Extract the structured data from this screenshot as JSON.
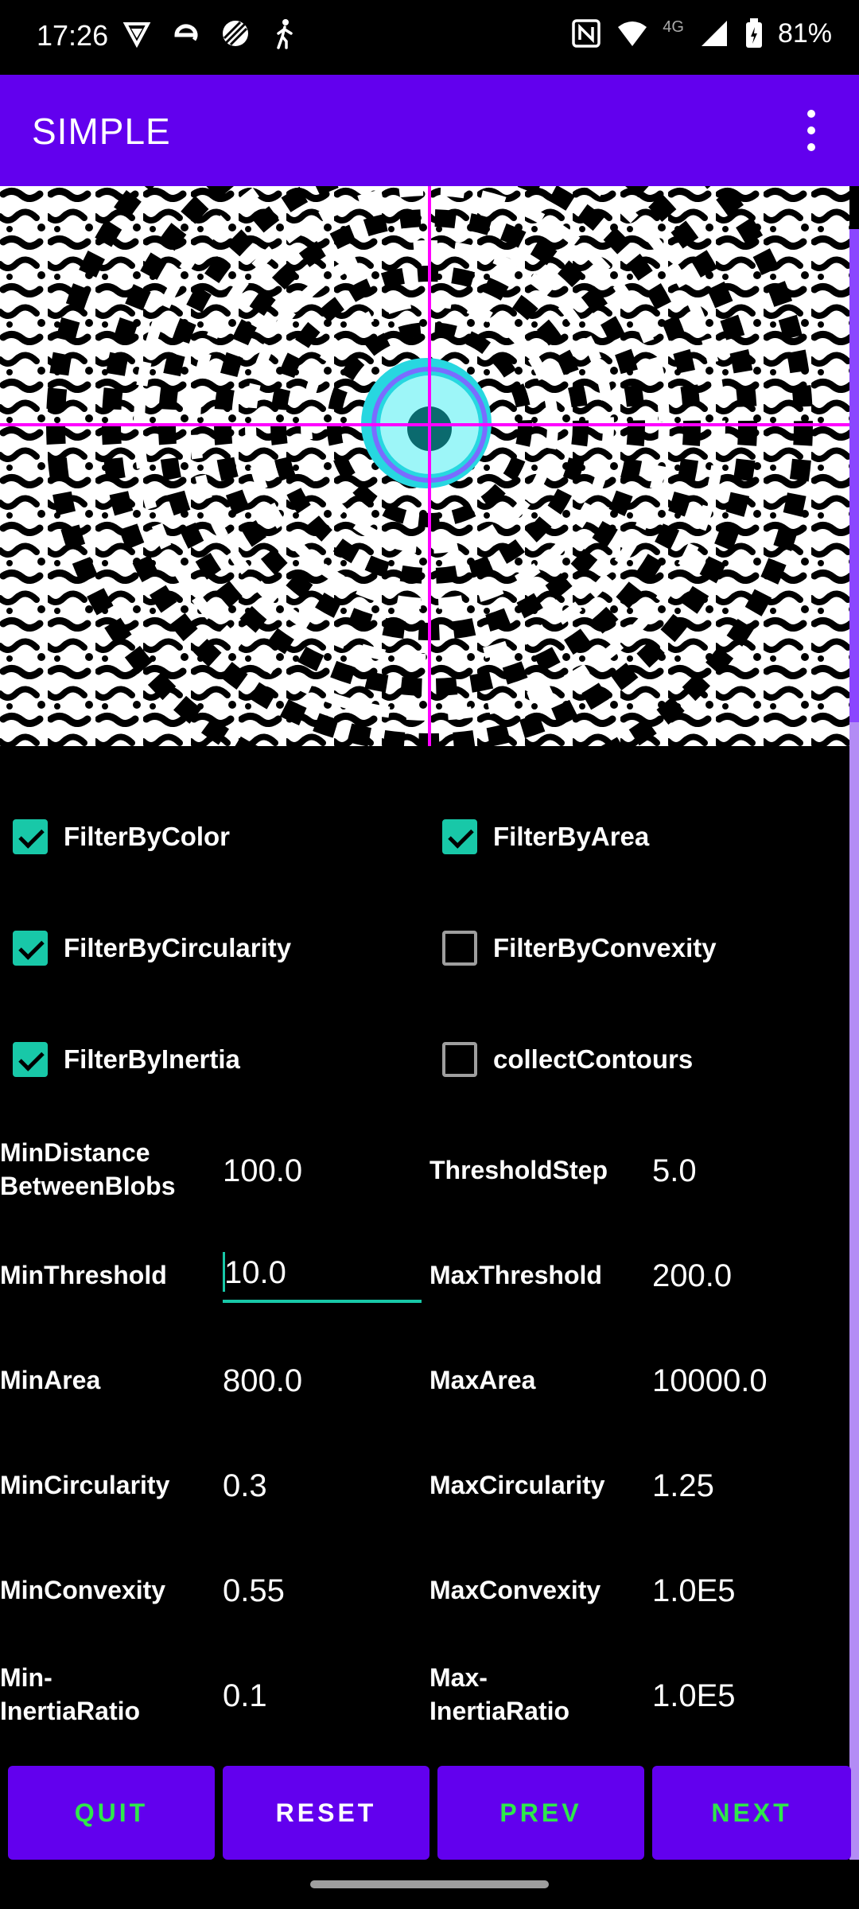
{
  "status_bar": {
    "time": "17:26",
    "network_label": "4G",
    "battery": "81%",
    "icons_left": [
      "vpn-shield-icon",
      "e-icon",
      "no-disturb-icon",
      "accessibility-walk-icon"
    ],
    "icons_right": [
      "nfc-icon",
      "wifi-icon",
      "signal-icon",
      "battery-icon"
    ]
  },
  "app_bar": {
    "title": "SIMPLE",
    "overflow_icon": "more-vert-icon"
  },
  "checkboxes": [
    {
      "label": "FilterByColor",
      "checked": true
    },
    {
      "label": "FilterByArea",
      "checked": true
    },
    {
      "label": "FilterByCircularity",
      "checked": true
    },
    {
      "label": "FilterByConvexity",
      "checked": false
    },
    {
      "label": "FilterByInertia",
      "checked": true
    },
    {
      "label": "collectContours",
      "checked": false
    }
  ],
  "params": {
    "min_distance": {
      "label_line1": "MinDistance",
      "label_line2": "BetweenBlobs",
      "value": "100.0"
    },
    "threshold_step": {
      "label": "ThresholdStep",
      "value": "5.0"
    },
    "min_threshold": {
      "label": "MinThreshold",
      "value": "10.0"
    },
    "max_threshold": {
      "label": "MaxThreshold",
      "value": "200.0"
    },
    "min_area": {
      "label": "MinArea",
      "value": "800.0"
    },
    "max_area": {
      "label": "MaxArea",
      "value": "10000.0"
    },
    "min_circularity": {
      "label": "MinCircularity",
      "value": "0.3"
    },
    "max_circularity": {
      "label": "MaxCircularity",
      "value": "1.25"
    },
    "min_convexity": {
      "label": "MinConvexity",
      "value": "0.55"
    },
    "max_convexity": {
      "label": "MaxConvexity",
      "value": "1.0E5"
    },
    "min_inertia": {
      "label_line1": "Min-",
      "label_line2": "InertiaRatio",
      "value": "0.1"
    },
    "max_inertia": {
      "label_line1": "Max-",
      "label_line2": "InertiaRatio",
      "value": "1.0E5"
    }
  },
  "buttons": {
    "quit": "QUIT",
    "reset": "RESET",
    "prev": "PREV",
    "next": "NEXT"
  },
  "colors": {
    "accent": "#6200ee",
    "checkbox": "#18c8a8",
    "crosshair": "#ff00ff",
    "blob_fill": "#27d7e0",
    "button_text_green": "#2ee84a"
  }
}
